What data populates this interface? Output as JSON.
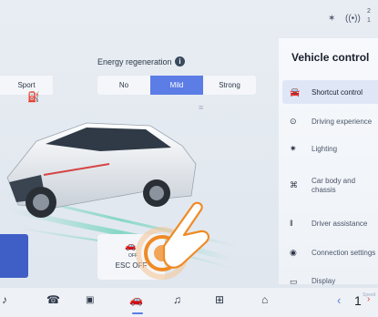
{
  "status": {
    "bluetooth_icon": "bluetooth-icon",
    "signal_icon": "signal-icon",
    "time_partial": [
      "2",
      "1"
    ]
  },
  "energy": {
    "title": "Energy regeneration",
    "left_option": "Sport",
    "options": [
      "No",
      "Mild",
      "Strong"
    ],
    "selected": "Mild"
  },
  "panel": {
    "title": "Vehicle control",
    "items": [
      {
        "label": "Shortcut control",
        "icon": "car-icon",
        "active": true
      },
      {
        "label": "Driving experience",
        "icon": "steering-wheel-icon",
        "active": false
      },
      {
        "label": "Lighting",
        "icon": "light-icon",
        "active": false
      },
      {
        "label": "Car body and chassis",
        "icon": "chassis-icon",
        "active": false
      },
      {
        "label": "Driver assistance",
        "icon": "driver-assist-icon",
        "active": false
      },
      {
        "label": "Connection settings",
        "icon": "connection-icon",
        "active": false
      },
      {
        "label": "Display",
        "icon": "display-icon",
        "active": false
      }
    ]
  },
  "esc": {
    "icon_label": "OFF",
    "label": "ESC OFF"
  },
  "dock": {
    "items": [
      "phone-icon",
      "camera-360-icon",
      "car-icon",
      "music-icon",
      "apps-icon",
      "home-icon"
    ],
    "speed_value": "1",
    "speed_label": "Speed"
  },
  "colors": {
    "accent": "#5c7ce6",
    "panel_bg": "#f4f7fb",
    "orange_hint": "#f08a24"
  }
}
